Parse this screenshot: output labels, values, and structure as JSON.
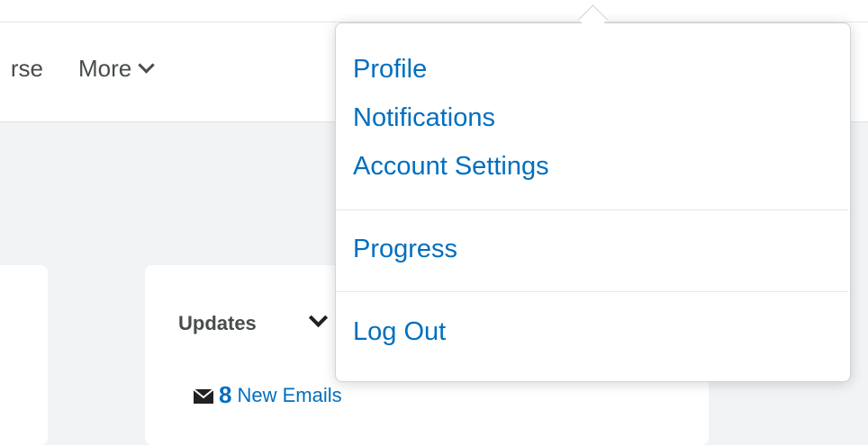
{
  "navbar": {
    "course_partial": "rse",
    "more_label": "More",
    "more_icon": "chevron-down-icon"
  },
  "updates_widget": {
    "title": "Updates",
    "collapse_icon": "chevron-down-icon",
    "email_icon": "envelope-icon",
    "email_count": "8",
    "email_label": "New Emails"
  },
  "user_menu": {
    "items": [
      {
        "label": "Profile"
      },
      {
        "label": "Notifications"
      },
      {
        "label": "Account Settings"
      },
      {
        "label": "Progress"
      },
      {
        "label": "Log Out"
      }
    ]
  },
  "colors": {
    "link": "#006fbf",
    "text": "#494c4e",
    "page_background": "#f1f3f5"
  }
}
